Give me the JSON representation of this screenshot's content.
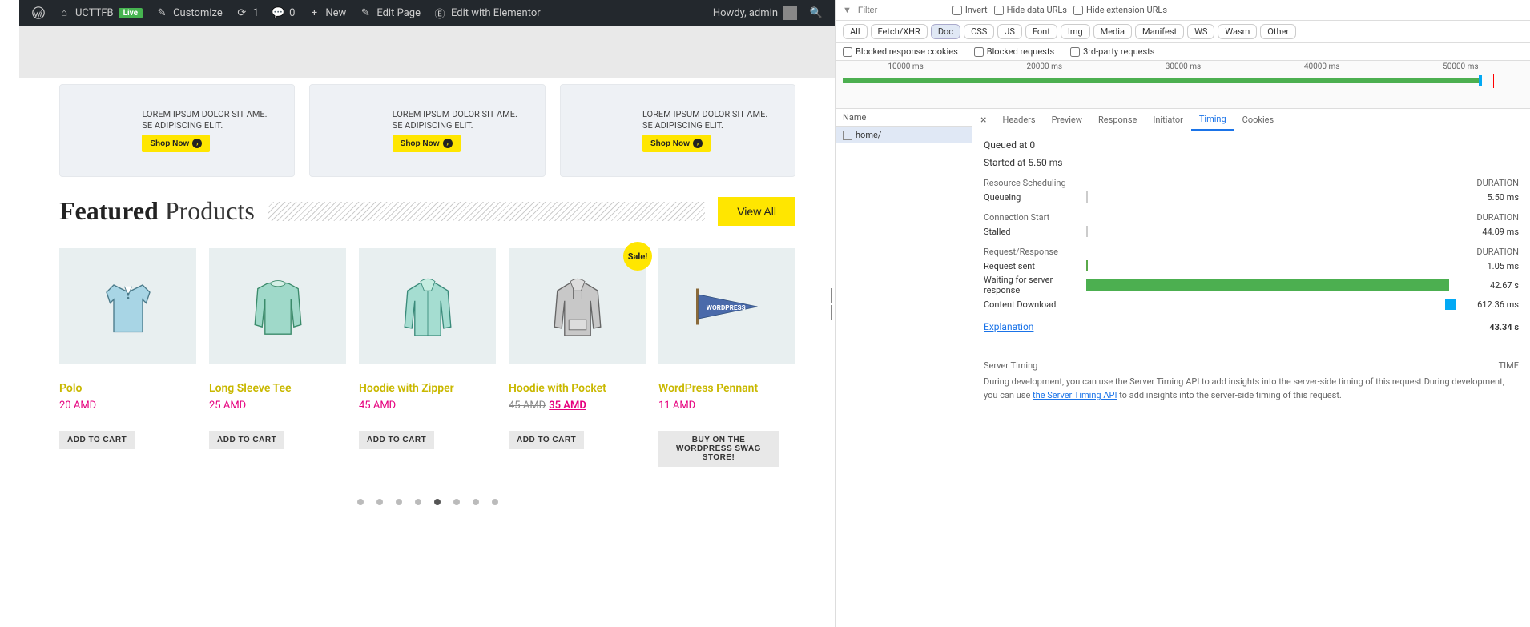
{
  "wp_bar": {
    "site": "UCTTFB",
    "live": "Live",
    "customize": "Customize",
    "updates": "1",
    "comments": "0",
    "new": "New",
    "edit_page": "Edit Page",
    "edit_elementor": "Edit with Elementor",
    "howdy": "Howdy, admin"
  },
  "promo": {
    "text": "LOREM IPSUM DOLOR SIT AME. SE ADIPISCING ELIT.",
    "shop": "Shop Now"
  },
  "featured": {
    "bold": "Featured",
    "light": "Products",
    "view_all": "View All",
    "add_to_cart": "ADD TO CART",
    "buy_swag": "BUY ON THE WORDPRESS SWAG STORE!",
    "sale": "Sale!"
  },
  "products": [
    {
      "name": "Polo",
      "price": "20 AMD",
      "btn": "add"
    },
    {
      "name": "Long Sleeve Tee",
      "price": "25 AMD",
      "btn": "add"
    },
    {
      "name": "Hoodie with Zipper",
      "price": "45 AMD",
      "btn": "add"
    },
    {
      "name": "Hoodie with Pocket",
      "old": "45 AMD",
      "new": "35 AMD",
      "btn": "add",
      "sale": true
    },
    {
      "name": "WordPress Pennant",
      "price": "11 AMD",
      "btn": "swag"
    }
  ],
  "devtools": {
    "filter_ph": "Filter",
    "invert": "Invert",
    "hide_data": "Hide data URLs",
    "hide_ext": "Hide extension URLs",
    "filter_chips": [
      "All",
      "Fetch/XHR",
      "Doc",
      "CSS",
      "JS",
      "Font",
      "Img",
      "Media",
      "Manifest",
      "WS",
      "Wasm",
      "Other"
    ],
    "blocked_cookies": "Blocked response cookies",
    "blocked_req": "Blocked requests",
    "third_party": "3rd-party requests",
    "timeline_ticks": [
      "10000 ms",
      "20000 ms",
      "30000 ms",
      "40000 ms",
      "50000 ms"
    ],
    "name_hdr": "Name",
    "request_name": "home/",
    "tabs": [
      "Headers",
      "Preview",
      "Response",
      "Initiator",
      "Timing",
      "Cookies"
    ],
    "queued": "Queued at 0",
    "started": "Started at 5.50 ms",
    "sec_sched": "Resource Scheduling",
    "sec_conn": "Connection Start",
    "sec_req": "Request/Response",
    "duration": "DURATION",
    "rows": {
      "queueing": {
        "label": "Queueing",
        "val": "5.50 ms"
      },
      "stalled": {
        "label": "Stalled",
        "val": "44.09 ms"
      },
      "sent": {
        "label": "Request sent",
        "val": "1.05 ms"
      },
      "waiting": {
        "label": "Waiting for server response",
        "val": "42.67 s"
      },
      "download": {
        "label": "Content Download",
        "val": "612.36 ms"
      }
    },
    "explain": "Explanation",
    "total": "43.34 s",
    "server_timing_hdr": "Server Timing",
    "time_hdr": "TIME",
    "server_desc_1": "During development, you can use the Server Timing API to add insights into the server-side timing of this request.During development, you can use ",
    "server_link": "the Server Timing API",
    "server_desc_2": " to add insights into the server-side timing of this request."
  }
}
